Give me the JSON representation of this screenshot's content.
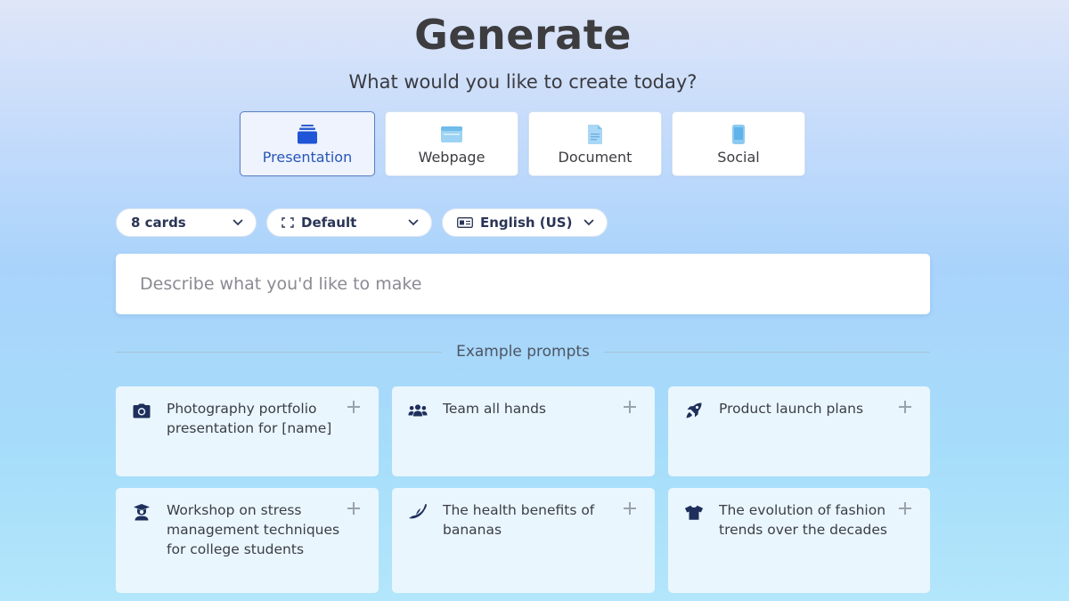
{
  "header": {
    "title": "Generate",
    "subtitle": "What would you like to create today?"
  },
  "content_types": [
    {
      "label": "Presentation",
      "icon": "presentation-icon",
      "selected": true
    },
    {
      "label": "Webpage",
      "icon": "webpage-icon",
      "selected": false
    },
    {
      "label": "Document",
      "icon": "document-icon",
      "selected": false
    },
    {
      "label": "Social",
      "icon": "social-icon",
      "selected": false
    }
  ],
  "options": {
    "cards": "8 cards",
    "theme": "Default",
    "language": "English (US)"
  },
  "prompt": {
    "placeholder": "Describe what you'd like to make"
  },
  "examples": {
    "heading": "Example prompts",
    "items": [
      {
        "text": "Photography portfolio presentation for [name]",
        "icon": "camera-icon"
      },
      {
        "text": "Team all hands",
        "icon": "users-icon"
      },
      {
        "text": "Product launch plans",
        "icon": "rocket-icon"
      },
      {
        "text": "Workshop on stress management techniques for college students",
        "icon": "graduate-icon"
      },
      {
        "text": "The health benefits of bananas",
        "icon": "banana-icon"
      },
      {
        "text": "The evolution of fashion trends over the decades",
        "icon": "tshirt-icon"
      }
    ]
  },
  "colors": {
    "accent": "#2756b8",
    "selected_border": "#5b7fc3",
    "icon_navy": "#1e2f5c"
  }
}
